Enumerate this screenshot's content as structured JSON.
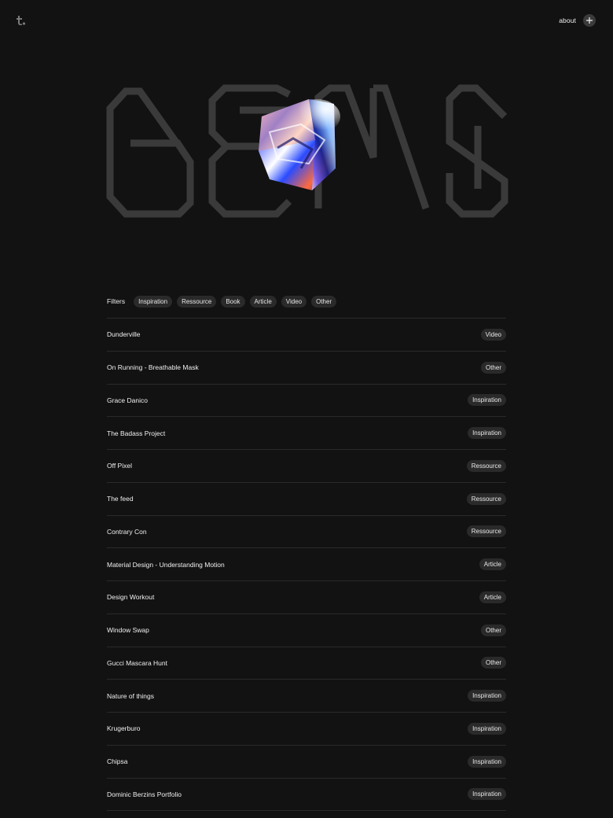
{
  "header": {
    "logo_icon": "t-logo-icon",
    "about_label": "about",
    "plus_icon": "plus-icon"
  },
  "hero": {
    "wordmark": "GEMS",
    "gem_icon": "holographic-gem-icon"
  },
  "filters": {
    "label": "Filters",
    "options": [
      "Inspiration",
      "Ressource",
      "Book",
      "Article",
      "Video",
      "Other"
    ]
  },
  "items": [
    {
      "title": "Dunderville",
      "tag": "Video"
    },
    {
      "title": "On Running - Breathable Mask",
      "tag": "Other"
    },
    {
      "title": "Grace Danico",
      "tag": "Inspiration"
    },
    {
      "title": "The Badass Project",
      "tag": "Inspiration"
    },
    {
      "title": "Off Pixel",
      "tag": "Ressource"
    },
    {
      "title": "The feed",
      "tag": "Ressource"
    },
    {
      "title": "Contrary Con",
      "tag": "Ressource"
    },
    {
      "title": "Material Design - Understanding Motion",
      "tag": "Article"
    },
    {
      "title": "Design Workout",
      "tag": "Article"
    },
    {
      "title": "Window Swap",
      "tag": "Other"
    },
    {
      "title": "Gucci Mascara Hunt",
      "tag": "Other"
    },
    {
      "title": "Nature of things",
      "tag": "Inspiration"
    },
    {
      "title": "Krugerburo",
      "tag": "Inspiration"
    },
    {
      "title": "Chipsa",
      "tag": "Inspiration"
    },
    {
      "title": "Dominic Berzins Portfolio",
      "tag": "Inspiration"
    }
  ],
  "colors": {
    "background": "#121212",
    "chip": "#2a2a2a",
    "divider": "#2a2a2a",
    "wordmark_stroke": "#3a3a3a"
  }
}
